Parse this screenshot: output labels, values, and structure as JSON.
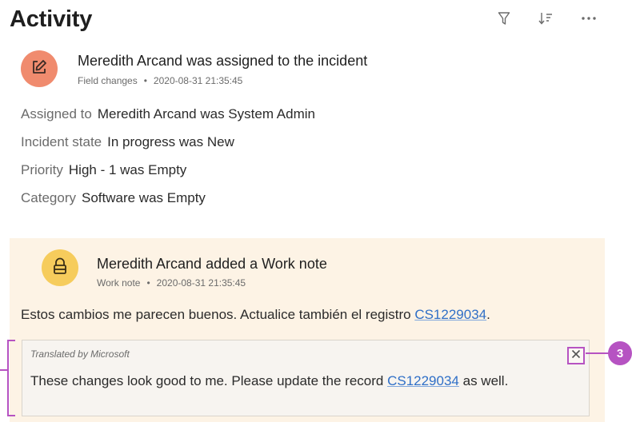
{
  "header": {
    "title": "Activity",
    "icons": [
      "filter-icon",
      "sort-icon",
      "more-icon"
    ]
  },
  "entries": [
    {
      "avatar_icon": "edit-icon",
      "avatar_color": "#f08b6e",
      "title": "Meredith Arcand was assigned to the incident",
      "type": "Field changes",
      "timestamp": "2020-08-31 21:35:45",
      "fields": [
        {
          "label": "Assigned to",
          "value": "Meredith Arcand was System Admin"
        },
        {
          "label": "Incident state",
          "value": "In progress was New"
        },
        {
          "label": "Priority",
          "value": "High - 1 was Empty"
        },
        {
          "label": "Category",
          "value": "Software was Empty"
        }
      ]
    },
    {
      "avatar_icon": "lock-icon",
      "avatar_color": "#f6cc5c",
      "panel_color": "#fdf3e5",
      "title": "Meredith Arcand added a Work note",
      "type": "Work note",
      "timestamp": "2020-08-31 21:35:45",
      "note_text": "Estos cambios me parecen buenos. Actualice también el registro ",
      "note_link": "CS1229034",
      "note_end": ".",
      "translation": {
        "label": "Translated by Microsoft",
        "text": "These changes look good to me. Please update the record ",
        "link": "CS1229034",
        "end": " as well.",
        "close_icon": "close-icon"
      }
    }
  ],
  "callout": {
    "number": "3",
    "color": "#b653c2"
  },
  "colors": {
    "link": "#2f6fc7",
    "accent": "#b653c2"
  }
}
